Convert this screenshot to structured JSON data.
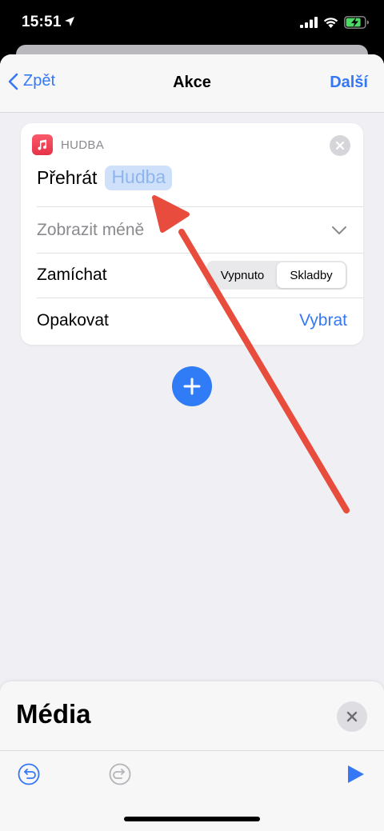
{
  "status_bar": {
    "time": "15:51"
  },
  "nav": {
    "back_label": "Zpět",
    "title": "Akce",
    "next_label": "Další"
  },
  "action_card": {
    "app_name": "HUDBA",
    "verb": "Přehrát",
    "token": "Hudba",
    "show_less": "Zobrazit méně",
    "shuffle": {
      "label": "Zamíchat",
      "options": [
        "Vypnuto",
        "Skladby"
      ],
      "selected": "Skladby"
    },
    "repeat": {
      "label": "Opakovat",
      "value": "Vybrat"
    }
  },
  "bottom_panel": {
    "title": "Média"
  },
  "colors": {
    "accent": "#3478f6",
    "annotation": "#e74c3c",
    "music_icon": "#f0455a"
  },
  "icons": [
    "location-arrow-icon",
    "signal-icon",
    "wifi-icon",
    "battery-charging-icon",
    "chevron-left-icon",
    "music-note-icon",
    "close-icon",
    "chevron-down-icon",
    "plus-icon",
    "undo-icon",
    "redo-icon",
    "play-icon"
  ]
}
